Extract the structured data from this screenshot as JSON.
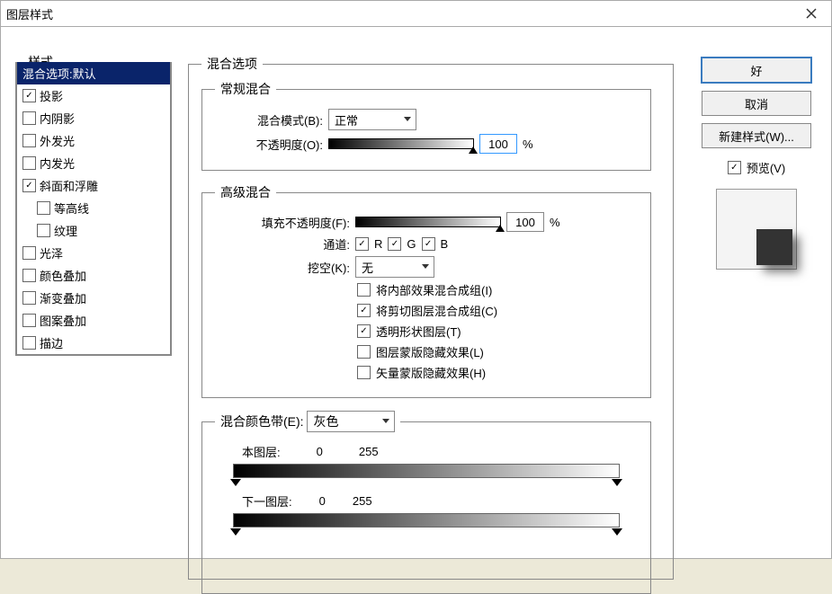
{
  "window": {
    "title": "图层样式"
  },
  "styles": {
    "header": "样式",
    "items": [
      {
        "label": "混合选项:默认",
        "checked": null,
        "selected": true
      },
      {
        "label": "投影",
        "checked": true
      },
      {
        "label": "内阴影",
        "checked": false
      },
      {
        "label": "外发光",
        "checked": false
      },
      {
        "label": "内发光",
        "checked": false
      },
      {
        "label": "斜面和浮雕",
        "checked": true
      },
      {
        "label": "等高线",
        "checked": false,
        "sub": true
      },
      {
        "label": "纹理",
        "checked": false,
        "sub": true
      },
      {
        "label": "光泽",
        "checked": false
      },
      {
        "label": "颜色叠加",
        "checked": false
      },
      {
        "label": "渐变叠加",
        "checked": false
      },
      {
        "label": "图案叠加",
        "checked": false
      },
      {
        "label": "描边",
        "checked": false
      }
    ]
  },
  "blend": {
    "title": "混合选项",
    "normal": {
      "title": "常规混合",
      "mode_label": "混合模式(B):",
      "mode_value": "正常",
      "opacity_label": "不透明度(O):",
      "opacity_value": "100",
      "pct": "%"
    },
    "advanced": {
      "title": "高级混合",
      "fill_label": "填充不透明度(F):",
      "fill_value": "100",
      "pct": "%",
      "channels_label": "通道:",
      "r": "R",
      "g": "G",
      "b": "B",
      "knockout_label": "挖空(K):",
      "knockout_value": "无",
      "opts": {
        "o1": {
          "label": "将内部效果混合成组(I)",
          "checked": false
        },
        "o2": {
          "label": "将剪切图层混合成组(C)",
          "checked": true
        },
        "o3": {
          "label": "透明形状图层(T)",
          "checked": true
        },
        "o4": {
          "label": "图层蒙版隐藏效果(L)",
          "checked": false
        },
        "o5": {
          "label": "矢量蒙版隐藏效果(H)",
          "checked": false
        }
      }
    },
    "blendif": {
      "label": "混合颜色带(E):",
      "value": "灰色",
      "this_label": "本图层:",
      "this_lo": "0",
      "this_hi": "255",
      "under_label": "下一图层:",
      "under_lo": "0",
      "under_hi": "255"
    }
  },
  "buttons": {
    "ok": "好",
    "cancel": "取消",
    "newstyle": "新建样式(W)...",
    "preview": "预览(V)"
  }
}
